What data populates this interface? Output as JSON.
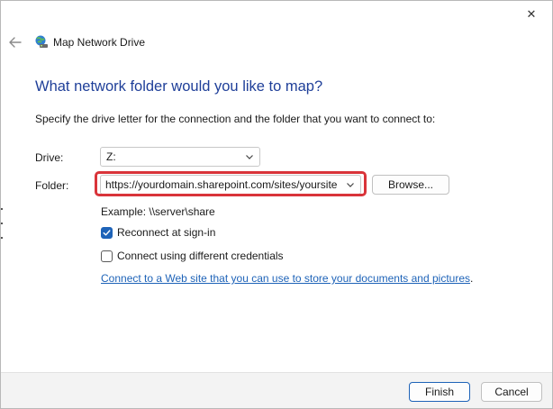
{
  "window": {
    "title": "Map Network Drive",
    "close_glyph": "✕",
    "back_icon": "back-arrow-icon",
    "app_icon": "network-drive-icon"
  },
  "content": {
    "heading": "What network folder would you like to map?",
    "instruction": "Specify the drive letter for the connection and the folder that you want to connect to:",
    "drive_label": "Drive:",
    "drive_value": "Z:",
    "folder_label": "Folder:",
    "folder_value": "https://yourdomain.sharepoint.com/sites/yoursite",
    "browse_label": "Browse...",
    "example": "Example: \\\\server\\share",
    "reconnect_label": "Reconnect at sign-in",
    "reconnect_checked": true,
    "credentials_label": "Connect using different credentials",
    "credentials_checked": false,
    "web_link_text": "Connect to a Web site that you can use to store your documents and pictures",
    "web_link_suffix": "."
  },
  "footer": {
    "finish_label": "Finish",
    "cancel_label": "Cancel"
  },
  "colors": {
    "heading": "#1f3f99",
    "accent": "#1e63b8",
    "highlight": "#d9343a"
  }
}
